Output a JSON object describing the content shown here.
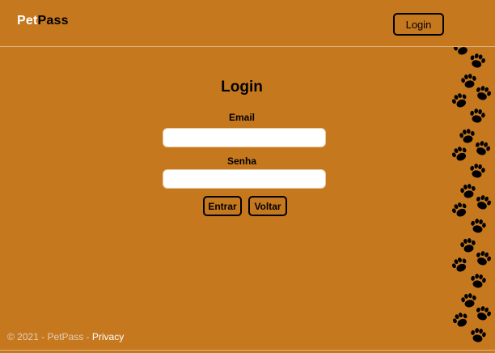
{
  "header": {
    "brand_part1": "Pet",
    "brand_part2": "Pass",
    "login_label": "Login"
  },
  "form": {
    "title": "Login",
    "email_label": "Email",
    "email_value": "",
    "password_label": "Senha",
    "password_value": "",
    "submit_label": "Entrar",
    "back_label": "Voltar"
  },
  "footer": {
    "copyright": "© 2021 - PetPass - ",
    "privacy_label": "Privacy"
  },
  "decoration": {
    "icon": "paw-print-icon",
    "color": "#000000"
  },
  "colors": {
    "background": "#c6781f",
    "brand_accent": "#ffffff"
  }
}
